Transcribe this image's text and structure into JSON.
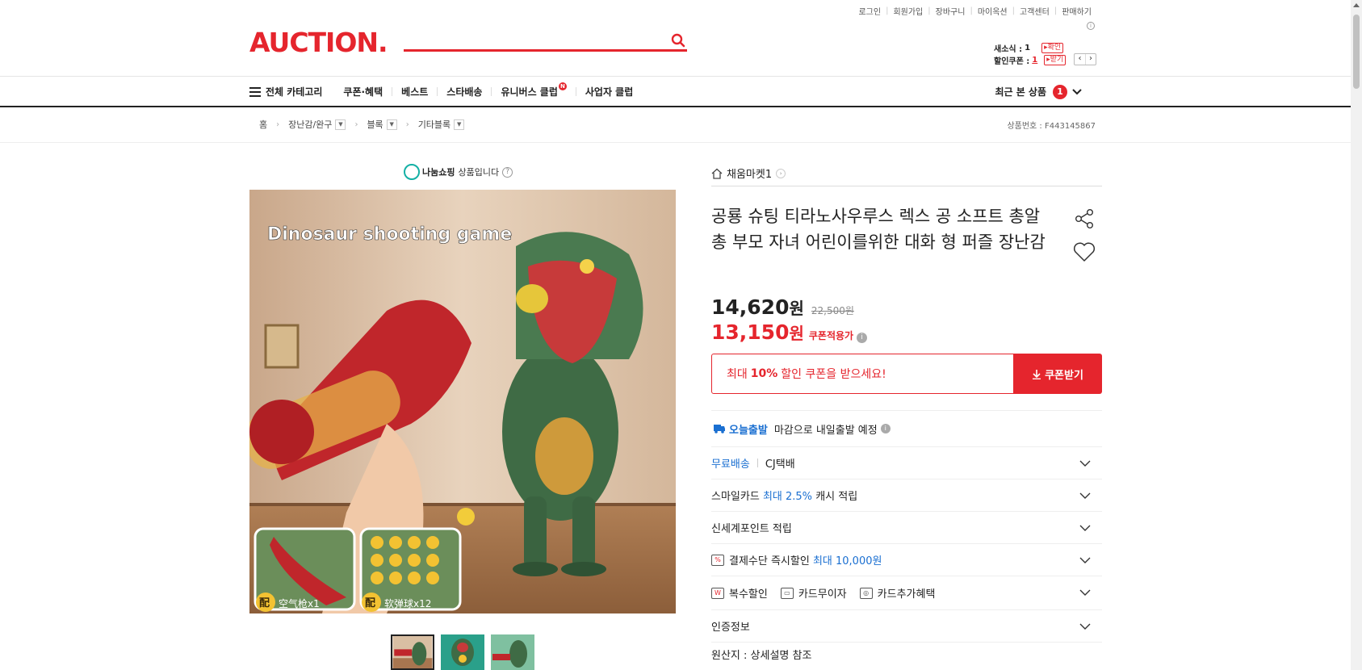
{
  "util_links": [
    "로그인",
    "회원가입",
    "장바구니",
    "마이옥션",
    "고객센터",
    "판매하기"
  ],
  "logo": "AUCTION.",
  "search": {
    "placeholder": ""
  },
  "mini": {
    "msg_label": "새소식 :",
    "msg_count": "1",
    "msg_btn": "▸확인",
    "coupon_label": "할인쿠폰 :",
    "coupon_count": "1",
    "coupon_btn": "▸받기"
  },
  "nav": {
    "all_categories": "전체 카테고리",
    "items": [
      "쿠폰·혜택",
      "베스트",
      "스타배송",
      "유니버스 클럽",
      "사업자 클럽"
    ],
    "universe_badge": "N",
    "recent_label": "최근 본 상품",
    "recent_count": "1"
  },
  "breadcrumb": [
    "홈",
    "장난감/완구",
    "블록",
    "기타블록"
  ],
  "product_no": "상품번호 : F443145867",
  "share_badge": {
    "logo_text": "나눔쇼핑",
    "text": "상품입니다",
    "help": "?"
  },
  "seller": "채움마켓1",
  "title": "공룡 슈팅 티라노사우루스 렉스 공 소프트 총알 총 부모 자녀 어린이를위한 대화 형 퍼즐 장난감",
  "price": {
    "sale": "14,620",
    "unit": "원",
    "original": "22,500원",
    "coupon_price": "13,150",
    "coupon_label": "쿠폰적용가"
  },
  "coupon": {
    "pre": "최대",
    "rate": "10%",
    "post": "할인 쿠폰을 받으세요!",
    "button": "쿠폰받기"
  },
  "delivery": {
    "today_label": "오늘출발",
    "today_text": "마감으로 내일출발 예정"
  },
  "rows": {
    "shipping_free": "무료배송",
    "shipping_carrier": "CJ택배",
    "smile_pre": "스마일카드",
    "smile_rate": "최대 2.5%",
    "smile_post": "캐시 적립",
    "ssg_point": "신세계포인트 적립",
    "pay_pre": "결제수단 즉시할인",
    "pay_amount": "최대 10,000원",
    "multi_discount": "복수할인",
    "card_interest": "카드무이자",
    "card_extra": "카드추가혜택",
    "certification": "인증정보",
    "origin": "원산지 : 상세설명 참조"
  },
  "image_caption": {
    "headline": "Dinosaur shooting game",
    "badge1": "配",
    "label1": "空气枪x1",
    "badge2": "配",
    "label2": "软弹球x12"
  },
  "colors": {
    "brand_red": "#e5252d",
    "link_blue": "#1a6fd1",
    "dino_green": "#3f6b45"
  }
}
